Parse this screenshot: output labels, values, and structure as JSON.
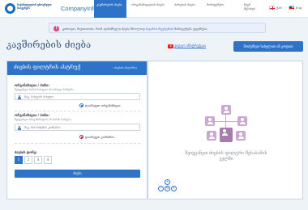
{
  "header": {
    "logo_text": "საქართველოს ეროვნული სააგენტო",
    "brand": "CompanyInfo",
    "nav": [
      {
        "label": "კავშირების ძიება",
        "active": true
      },
      {
        "label": "ორგანიზაციების ძიება"
      },
      {
        "label": "პირების ძიება"
      },
      {
        "label": "მონაცემები"
      },
      {
        "label": "ჩვენ შესახებ"
      }
    ],
    "lang_ge": "ქარ",
    "lang_en": "Eng"
  },
  "notice": {
    "icon": "!",
    "text_before": "გთხოვთ, მიუთითოთ, რომ აღნიშნული ძიება მხოლოდ",
    "link": "საჯარო რეესტრის",
    "text_after": "მონაცემებს ეფუძნება."
  },
  "page": {
    "title": "კავშირების ძიება",
    "video_link": "ვიდეო ინსტრუქცია",
    "search_by_title_button": "მოძებნეთ სახელით ან კოდით"
  },
  "filters": {
    "title": "ძიების ფილტრის ასტრუქ",
    "back_link": "ძიების ისტორია",
    "first": {
      "label": "ორგანიზაცია / პირი:",
      "hint": "შეიყვანეთ პირის სახელი ან პირადი ნომერი",
      "placeholder": "მაგ. ნახევარ სახელი",
      "add_label": "დაამატეთ ორგანიზაცია"
    },
    "second": {
      "label": "ორგანიზაცია / პირი:",
      "hint": "შეიყვანეთ ორგანიზაციის ან პირის სახელი",
      "placeholder": "მაგ. შპს ნიმუშის კომპანია",
      "add_label": "დაამატეთ კომპანია"
    },
    "rows_label": "ძიების დონე:",
    "pages": [
      "1",
      "2",
      "3",
      "4"
    ],
    "active_page": "1",
    "search_button": "ძიება"
  },
  "result": {
    "empty_text": "შეიყვანეთ ძიების ფილტრი შესაბამის ველში",
    "controls": [
      "+",
      "−",
      "⟲"
    ]
  }
}
